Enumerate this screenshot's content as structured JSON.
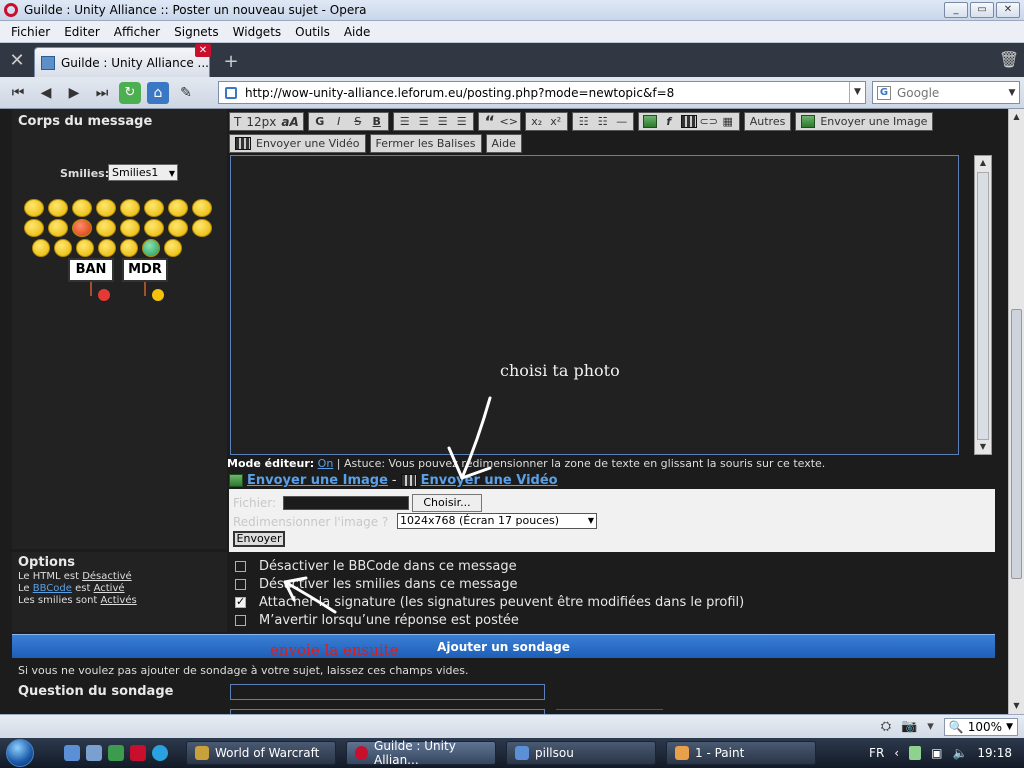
{
  "window": {
    "title": "Guilde : Unity Alliance :: Poster un nouveau sujet - Opera",
    "btn_min": "_",
    "btn_max": "▭",
    "btn_close": "✕"
  },
  "menu": {
    "items": [
      "Fichier",
      "Editer",
      "Afficher",
      "Signets",
      "Widgets",
      "Outils",
      "Aide"
    ]
  },
  "tabs": {
    "active_label": "Guilde : Unity Alliance ...",
    "close_glyph": "✕",
    "new_tab_glyph": "+"
  },
  "nav": {
    "url": "http://wow-unity-alliance.leforum.eu/posting.php?mode=newtopic&f=8",
    "search_placeholder": "Google",
    "search_engine_glyph": "G"
  },
  "form": {
    "message_section_title": "Corps du message",
    "smilies_label": "Smilies:",
    "smilies_select_value": "Smilies1",
    "sign_ban": "BAN",
    "sign_mdr": "MDR",
    "toolbar": {
      "font_size": "12px",
      "font_glyph": "aA",
      "bold": "G",
      "italic": "I",
      "strike": "S",
      "underline": "B",
      "quote": "“",
      "code": "<>",
      "sub": "x₂",
      "sup": "x²",
      "other": "Autres",
      "send_image": "Envoyer une Image",
      "send_video": "Envoyer une Vidéo",
      "close_tags": "Fermer les Balises",
      "help": "Aide"
    },
    "editor_mode_label": "Mode éditeur:",
    "editor_mode_value": "On",
    "editor_tip": "| Astuce: Vous pouvez redimensionner la zone de texte en glissant la souris sur ce texte.",
    "upload_image_link": "Envoyer une Image",
    "upload_video_link": "Envoyer une Vidéo",
    "upload_separator": "-",
    "file_label": "Fichier:",
    "choose_button": "Choisir...",
    "resize_label": "Redimensionner l'image ?",
    "resize_value": "1024x768 (Écran 17 pouces)",
    "send_button": "Envoyer"
  },
  "annotations": {
    "photo_hint": "choisi ta photo",
    "send_hint": "envoie la ensuite"
  },
  "options": {
    "title": "Options",
    "html_prefix": "Le HTML est",
    "html_value": "Désactivé",
    "bbcode_prefix": "Le",
    "bbcode_link": "BBCode",
    "bbcode_middle": "est",
    "bbcode_value": "Activé",
    "smilies_prefix": "Les smilies sont",
    "smilies_value": "Activés",
    "checks": [
      {
        "label": "Désactiver le BBCode dans ce message",
        "checked": false
      },
      {
        "label": "Désactiver les smilies dans ce message",
        "checked": false
      },
      {
        "label": "Attacher la signature (les signatures peuvent être modifiées dans le profil)",
        "checked": true
      },
      {
        "label": "M’avertir lorsqu’une réponse est postée",
        "checked": false
      }
    ]
  },
  "poll": {
    "title": "Ajouter un sondage",
    "hint": "Si vous ne voulez pas ajouter de sondage à votre sujet, laissez ces champs vides.",
    "question_label": "Question du sondage"
  },
  "status": {
    "zoom": "100%"
  },
  "taskbar": {
    "items": [
      {
        "label": "World of Warcraft",
        "color": "#c8a03c",
        "active": false
      },
      {
        "label": "Guilde : Unity Allian...",
        "color": "#c8102e",
        "active": true
      },
      {
        "label": "pillsou",
        "color": "#5b8fd6",
        "active": false
      },
      {
        "label": "1 - Paint",
        "color": "#e8a04a",
        "active": false
      }
    ],
    "lang": "FR",
    "time": "19:18"
  }
}
